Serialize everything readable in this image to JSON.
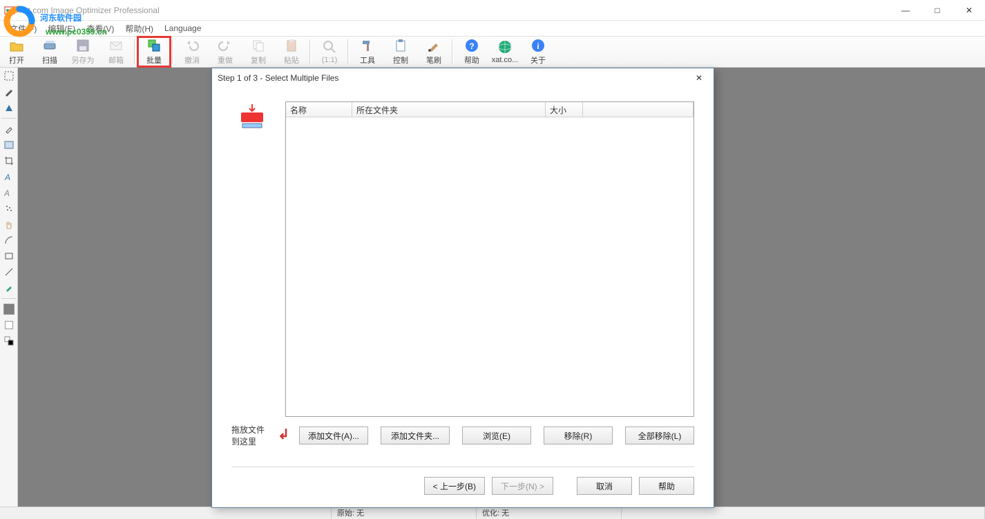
{
  "window": {
    "title": "xat.com  Image Optimizer Professional"
  },
  "window_controls": {
    "min": "—",
    "max": "□",
    "close": "✕"
  },
  "menu": {
    "file": "文件(F)",
    "edit": "编辑(E)",
    "view": "查看(V)",
    "help": "帮助(H)",
    "language": "Language"
  },
  "toolbar": {
    "open": "打开",
    "scan": "扫描",
    "saveas": "另存为",
    "mail": "邮箱",
    "batch": "批量",
    "undo": "撤消",
    "redo": "重做",
    "copy": "复制",
    "paste": "粘贴",
    "oneToOne": "(1:1)",
    "tools": "工具",
    "ctrl": "控制",
    "brush": "笔刷",
    "helpBtn": "帮助",
    "xat": "xat.co...",
    "about": "关于"
  },
  "watermark": {
    "brand": "河东软件园",
    "url": "www.pc0359.cn"
  },
  "dialog": {
    "title": "Step 1 of 3 - Select Multiple Files",
    "cols": {
      "name": "名称",
      "folder": "所在文件夹",
      "size": "大小"
    },
    "dragHint": "拖放文件到这里",
    "addFiles": "添加文件(A)...",
    "addFolder": "添加文件夹...",
    "browse": "浏览(E)",
    "remove": "移除(R)",
    "removeAll": "全部移除(L)",
    "back": "< 上一步(B)",
    "next": "下一步(N) >",
    "cancel": "取消",
    "help": "帮助"
  },
  "status": {
    "original": "原始: 无",
    "optimized": "优化: 无"
  }
}
